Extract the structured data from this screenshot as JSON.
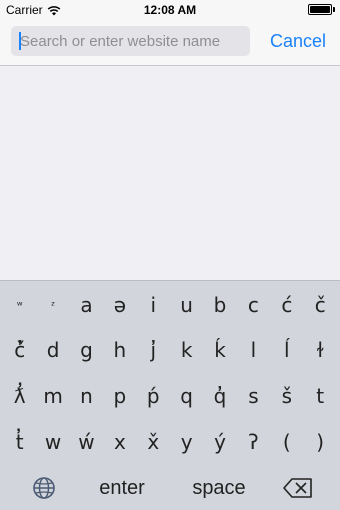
{
  "status_bar": {
    "carrier": "Carrier",
    "time": "12:08 AM"
  },
  "navbar": {
    "search_placeholder": "Search or enter website name",
    "search_value": "",
    "cancel_label": "Cancel"
  },
  "keyboard": {
    "row1": [
      "ʷ",
      "ᶻ",
      "a",
      "ə",
      "i",
      "u",
      "b",
      "c",
      "ć",
      "č"
    ],
    "row2": [
      "č̓",
      "d",
      "g",
      "h",
      "ȷ̓",
      "k",
      "ḱ",
      "l",
      "ĺ",
      "ɫ"
    ],
    "row3": [
      "ƛ̓",
      "m",
      "n",
      "p",
      "ṕ",
      "q",
      "q̓",
      "s",
      "š",
      "t"
    ],
    "row4": [
      "t̓",
      "w",
      "ẃ",
      "x",
      "x̌",
      "y",
      "ý",
      "ʔ",
      "(",
      ")"
    ],
    "globe": "globe-icon",
    "enter_label": "enter",
    "space_label": "space",
    "delete": "delete-backspace-icon"
  },
  "colors": {
    "accent": "#1a82fb",
    "keyboard_bg": "#d2d5db",
    "navbar_bg": "#f7f7f7",
    "content_bg": "#efeff4"
  }
}
